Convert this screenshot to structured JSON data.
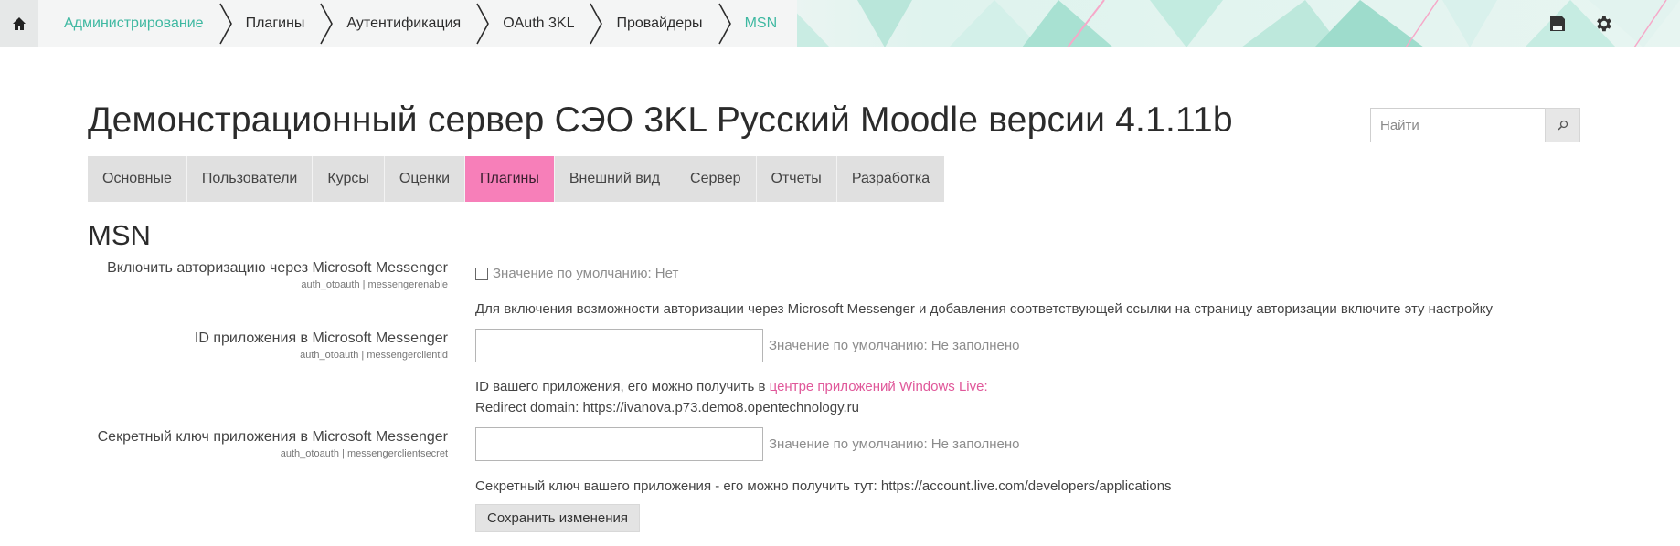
{
  "breadcrumb": {
    "items": [
      {
        "label": "Администрирование",
        "link": true
      },
      {
        "label": "Плагины",
        "link": false
      },
      {
        "label": "Аутентификация",
        "link": false
      },
      {
        "label": "OAuth 3KL",
        "link": false
      },
      {
        "label": "Провайдеры",
        "link": false
      },
      {
        "label": "MSN",
        "link": true
      }
    ],
    "accent": "#3eb8a1"
  },
  "top_icons": {
    "home": "home-icon",
    "save": "floppy-disk-icon",
    "settings": "gear-icon"
  },
  "header": {
    "site_title": "Демонстрационный сервер СЭО 3KL Русский Moodle версии 4.1.11b",
    "search_placeholder": "Найти",
    "search_icon": "search-icon"
  },
  "tabs": [
    {
      "label": "Основные",
      "active": false
    },
    {
      "label": "Пользователи",
      "active": false
    },
    {
      "label": "Курсы",
      "active": false
    },
    {
      "label": "Оценки",
      "active": false
    },
    {
      "label": "Плагины",
      "active": true
    },
    {
      "label": "Внешний вид",
      "active": false
    },
    {
      "label": "Сервер",
      "active": false
    },
    {
      "label": "Отчеты",
      "active": false
    },
    {
      "label": "Разработка",
      "active": false
    }
  ],
  "tab_active_color": "#f77fb9",
  "section_title": "MSN",
  "settings": {
    "enable": {
      "label": "Включить авторизацию через Microsoft Messenger",
      "key": "auth_otoauth | messengerenable",
      "default": "Значение по умолчанию: Нет",
      "description": "Для включения возможности авторизации через Microsoft Messenger и добавления соответствующей ссылки на страницу авторизации включите эту настройку",
      "checked": false
    },
    "client_id": {
      "label": "ID приложения в Microsoft Messenger",
      "key": "auth_otoauth | messengerclientid",
      "value": "",
      "default": "Значение по умолчанию: Не заполнено",
      "description_prefix": "ID вашего приложения, его можно получить в ",
      "description_link": "центре приложений Windows Live:",
      "redirect": "Redirect domain: https://ivanova.p73.demo8.opentechnology.ru"
    },
    "client_secret": {
      "label": "Секретный ключ приложения в Microsoft Messenger",
      "key": "auth_otoauth | messengerclientsecret",
      "value": "",
      "default": "Значение по умолчанию: Не заполнено",
      "description": "Секретный ключ вашего приложения - его можно получить тут: https://account.live.com/developers/applications"
    }
  },
  "save_button": "Сохранить изменения",
  "link_color": "#e0589a"
}
